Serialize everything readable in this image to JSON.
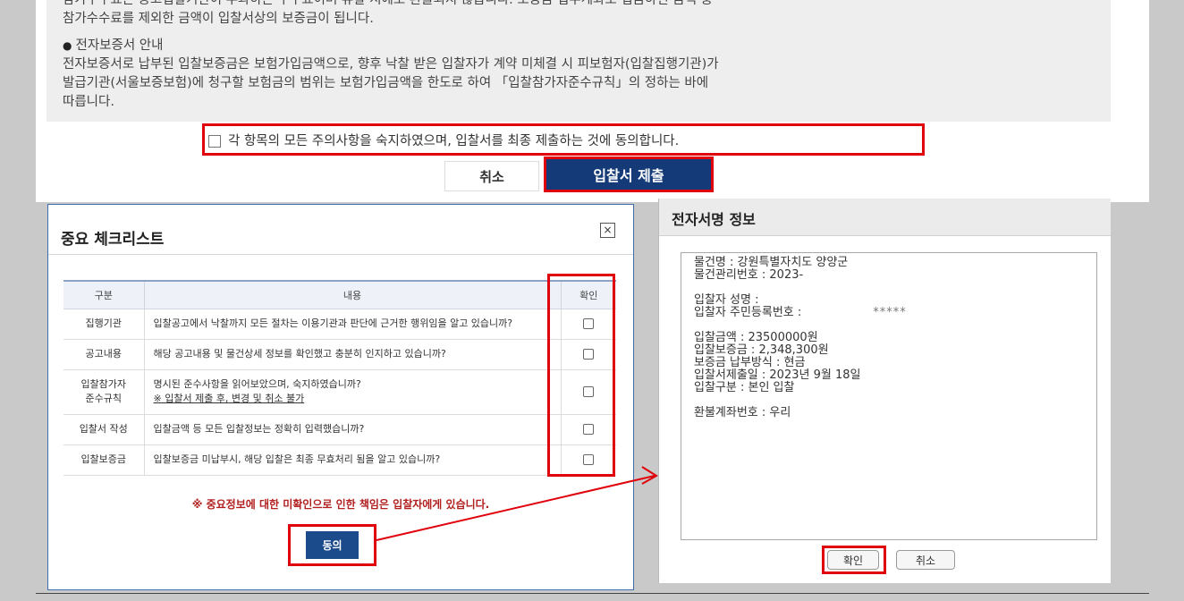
{
  "notice": {
    "line0": "참가수수료는 공고입찰기관이 부과하는 수수료이며 유찰 시에도 환불되지 않습니다. 보증금 입부계좌로 입금하신 금액 중",
    "line1": "참가수수료를 제외한 금액이 입찰서상의 보증금이 됩니다.",
    "section_title": "전자보증서 안내",
    "line2": "전자보증서로 납부된 입찰보증금은 보험가입금액으로, 향후 낙찰 받은 입찰자가 계약 미체결 시 피보험자(입찰집행기관)가",
    "line3": "발급기관(서울보증보험)에 청구할 보험금의 범위는 보험가입금액을 한도로 하여 「입찰참가자준수규칙」의 정하는 바에",
    "line4": "따릅니다."
  },
  "agreement": {
    "text": "각 항목의 모든 주의사항을 숙지하였으며, 입찰서를 최종 제출하는 것에 동의합니다.",
    "checked": false
  },
  "top_buttons": {
    "cancel": "취소",
    "submit": "입찰서 제출"
  },
  "checklist": {
    "title": "중요 체크리스트",
    "close_symbol": "×",
    "headers": {
      "category": "구분",
      "content": "내용",
      "confirm": "확인"
    },
    "rows": [
      {
        "category": "집행기관",
        "content": "입찰공고에서 낙찰까지 모든 절차는 이용기관과 판단에 근거한 행위임을 알고 있습니까?",
        "checked": false
      },
      {
        "category": "공고내용",
        "content": "해당 공고내용 및 물건상세 정보를 확인했고 충분히 인지하고 있습니까?",
        "checked": false
      },
      {
        "category": "입찰참가자\n준수규칙",
        "content": "명시된 준수사항을 읽어보았으며, 숙지하였습니까?",
        "note": "※ 입찰서 제출 후, 변경 및 취소 불가",
        "checked": false
      },
      {
        "category": "입찰서 작성",
        "content": "입찰금액 등 모든 입찰정보는 정확히 입력했습니까?",
        "checked": false
      },
      {
        "category": "입찰보증금",
        "content": "입찰보증금 미납부시, 해당 입찰은 최종 무효처리 됨을 알고 있습니까?",
        "checked": false
      }
    ],
    "warning": "※ 중요정보에 대한 미확인으로 인한 책임은 입찰자에게 있습니다.",
    "agree_button": "동의"
  },
  "signature": {
    "title": "전자서명 정보",
    "item_name": "물건명 : 강원특별자치도 양양군",
    "item_no": "물건관리번호 : 2023-",
    "bidder_name": "입찰자 성명 :",
    "bidder_id": "입찰자 주민등록번호 :",
    "bidder_id_masked": "*****",
    "bid_amount": "입찰금액 : 23500000원",
    "deposit": "입찰보증금 : 2,348,300원",
    "deposit_method": "보증금 납부방식 : 현금",
    "submit_date": "입찰서제출일 : 2023년 9월 18일",
    "bid_type": "입찰구분 : 본인 입찰",
    "refund_account": "환불계좌번호 : 우리",
    "ok_button": "확인",
    "cancel_button": "취소"
  },
  "colors": {
    "highlight": "#e0000b",
    "primary_navy": "#143a78",
    "agree_blue": "#1c4b8c",
    "warning_red": "#b22020",
    "backdrop": "#c9c9c9"
  }
}
